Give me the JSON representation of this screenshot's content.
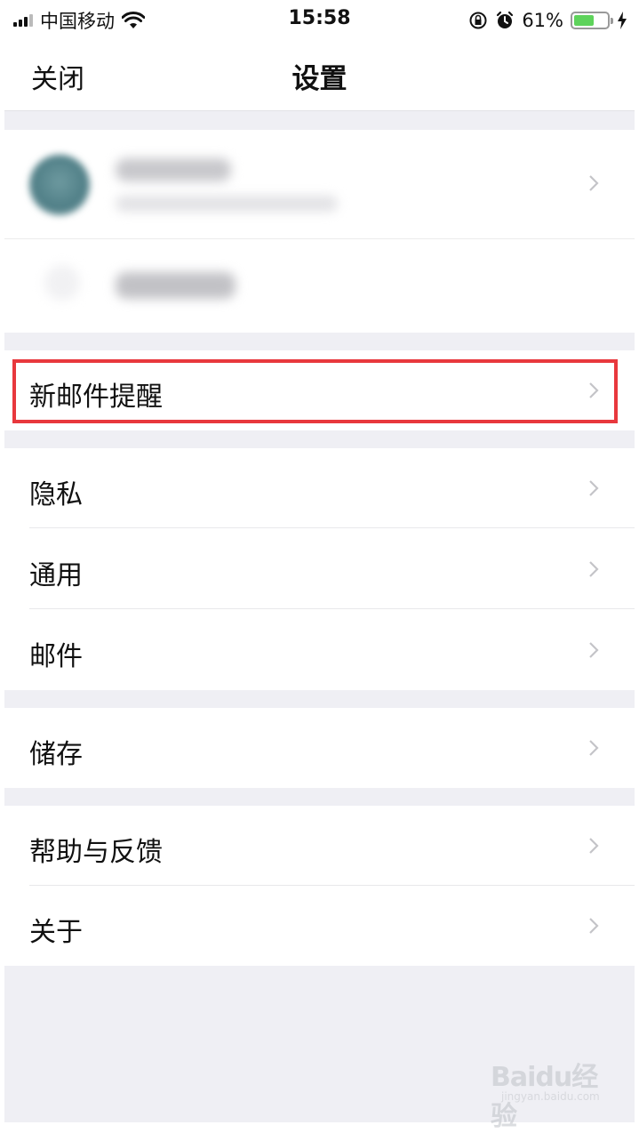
{
  "status_bar": {
    "carrier": "中国移动",
    "time": "15:58",
    "battery_percent": "61%",
    "battery_level": 0.61,
    "battery_color": "#5ed35b"
  },
  "nav": {
    "close_label": "关闭",
    "title": "设置"
  },
  "menu": {
    "new_mail_alert": "新邮件提醒",
    "privacy": "隐私",
    "general": "通用",
    "mail": "邮件",
    "storage": "储存",
    "help_feedback": "帮助与反馈",
    "about": "关于"
  },
  "highlight_color": "#e8383d",
  "watermark": {
    "text": "Baidu经验",
    "sub": "jingyan.baidu.com"
  }
}
